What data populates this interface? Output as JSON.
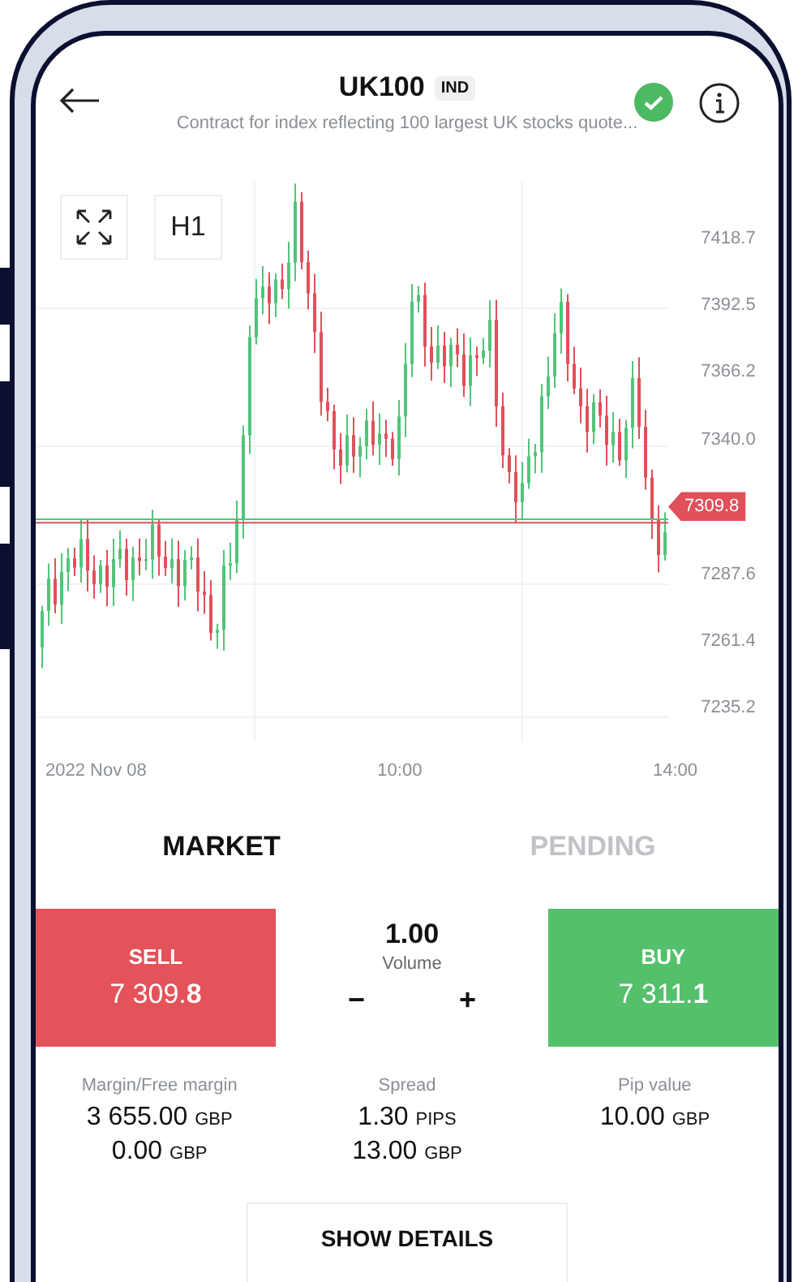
{
  "header": {
    "title": "UK100",
    "badge": "IND",
    "subtitle": "Contract for index reflecting 100 largest UK stocks quote..."
  },
  "chart": {
    "timeframe": "H1",
    "y_axis_labels": [
      "7418.7",
      "7392.5",
      "7366.2",
      "7340.0",
      "7287.6",
      "7261.4",
      "7235.2"
    ],
    "price_tag": "7309.8",
    "x_axis_labels": [
      "2022 Nov 08",
      "10:00",
      "14:00"
    ]
  },
  "tabs": [
    {
      "label": "MARKET",
      "selected": true
    },
    {
      "label": "PENDING",
      "selected": false
    }
  ],
  "sell": {
    "label": "SELL",
    "price": "7 309.**8**"
  },
  "volume": {
    "value": "1.00",
    "label": "Volume",
    "minus": "−",
    "plus": "+"
  },
  "buy": {
    "label": "BUY",
    "price": "7 311.**1**"
  },
  "info": [
    {
      "label": "Margin/Free margin",
      "values": [
        {
          "amount": "3 655.00",
          "unit": "GBP"
        },
        {
          "amount": "0.00",
          "unit": "GBP"
        }
      ]
    },
    {
      "label": "Spread",
      "values": [
        {
          "amount": "1.30",
          "unit": "PIPS"
        },
        {
          "amount": "13.00",
          "unit": "GBP"
        }
      ]
    },
    {
      "label": "Pip value",
      "values": [
        {
          "amount": "10.00",
          "unit": "GBP"
        }
      ]
    }
  ],
  "details_button": "SHOW DETAILS"
}
